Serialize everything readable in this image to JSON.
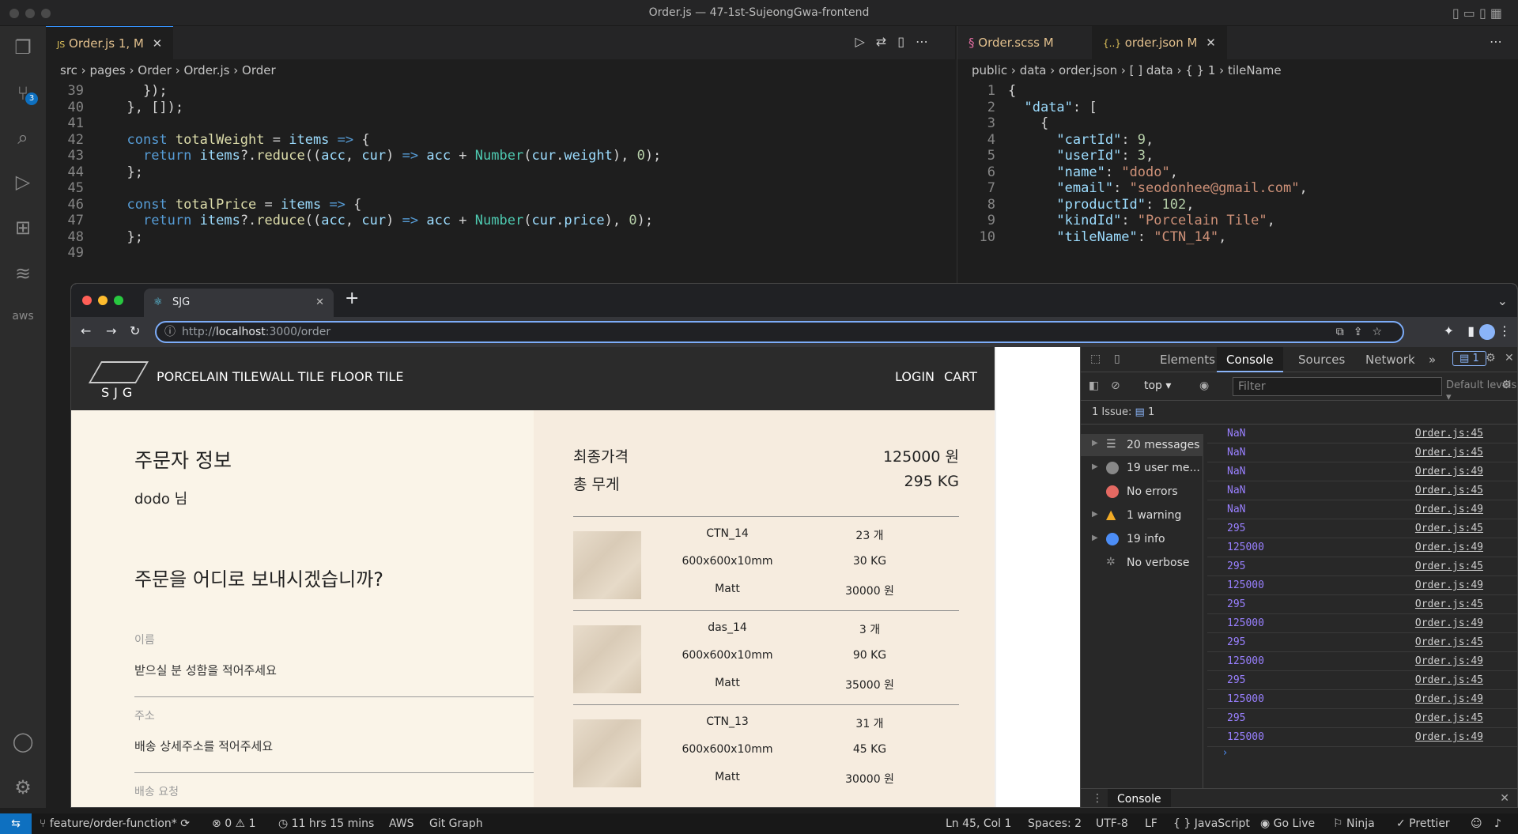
{
  "window": {
    "title": "Order.js — 47-1st-SujeongGwa-frontend"
  },
  "editor_left": {
    "tab_label": "Order.js",
    "tab_status": "1, M",
    "breadcrumb": [
      "src",
      "pages",
      "Order",
      "Order.js",
      "Order"
    ],
    "lines": [
      {
        "n": "39",
        "t": "    });"
      },
      {
        "n": "40",
        "t": "  }, []);"
      },
      {
        "n": "41",
        "t": ""
      },
      {
        "n": "42",
        "t": "  const totalWeight = items => {"
      },
      {
        "n": "43",
        "t": "    return items?.reduce((acc, cur) => acc + Number(cur.weight), 0);"
      },
      {
        "n": "44",
        "t": "  };"
      },
      {
        "n": "45",
        "t": ""
      },
      {
        "n": "46",
        "t": "  const totalPrice = items => {"
      },
      {
        "n": "47",
        "t": "    return items?.reduce((acc, cur) => acc + Number(cur.price), 0);"
      },
      {
        "n": "48",
        "t": "  };"
      },
      {
        "n": "49",
        "t": ""
      }
    ]
  },
  "editor_right": {
    "tabs": [
      {
        "label": "Order.scss",
        "status": "M"
      },
      {
        "label": "order.json",
        "status": "M"
      }
    ],
    "breadcrumb": [
      "public",
      "data",
      "order.json",
      "[ ] data",
      "{ } 1",
      "tileName"
    ],
    "lines": [
      {
        "n": "1",
        "t": "{"
      },
      {
        "n": "2",
        "t": "  \"data\": ["
      },
      {
        "n": "3",
        "t": "    {"
      },
      {
        "n": "4",
        "t": "      \"cartId\": 9,"
      },
      {
        "n": "5",
        "t": "      \"userId\": 3,"
      },
      {
        "n": "6",
        "t": "      \"name\": \"dodo\","
      },
      {
        "n": "7",
        "t": "      \"email\": \"seodonhee@gmail.com\","
      },
      {
        "n": "8",
        "t": "      \"productId\": 102,"
      },
      {
        "n": "9",
        "t": "      \"kindId\": \"Porcelain Tile\","
      },
      {
        "n": "10",
        "t": "      \"tileName\": \"CTN_14\","
      }
    ]
  },
  "activity_badge": "3",
  "browser": {
    "tab_title": "SJG",
    "url_prefix": "http://",
    "url_host": "localhost",
    "url_path": ":3000/order"
  },
  "site": {
    "logo": "SJG",
    "nav": [
      "PORCELAIN TILE",
      "WALL TILE",
      "FLOOR TILE"
    ],
    "nav_right": [
      "LOGIN",
      "CART"
    ],
    "orderer_title": "주문자 정보",
    "user_name": "dodo 님",
    "ship_title": "주문을 어디로 보내시겠습니까?",
    "fields": [
      {
        "label": "이름",
        "placeholder": "받으실 분 성함을 적어주세요"
      },
      {
        "label": "주소",
        "placeholder": "배송 상세주소를 적어주세요"
      },
      {
        "label": "배송 요청",
        "placeholder": ""
      }
    ],
    "summary": {
      "price_label": "최종가격",
      "price_value": "125000 원",
      "weight_label": "총 무게",
      "weight_value": "295 KG"
    },
    "products": [
      {
        "name": "CTN_14",
        "size": "600x600x10mm",
        "finish": "Matt",
        "qty": "23 개",
        "weight": "30 KG",
        "price": "30000 원"
      },
      {
        "name": "das_14",
        "size": "600x600x10mm",
        "finish": "Matt",
        "qty": "3 개",
        "weight": "90 KG",
        "price": "35000 원"
      },
      {
        "name": "CTN_13",
        "size": "600x600x10mm",
        "finish": "Matt",
        "qty": "31 개",
        "weight": "45 KG",
        "price": "30000 원"
      }
    ]
  },
  "devtools": {
    "tabs": [
      "Elements",
      "Console",
      "Sources",
      "Network"
    ],
    "issue_badge": "1",
    "context": "top",
    "filter_placeholder": "Filter",
    "levels": "Default levels",
    "issues_bar": "1 Issue:",
    "issues_count": "1",
    "sidebar": [
      "20 messages",
      "19 user me...",
      "No errors",
      "1 warning",
      "19 info",
      "No verbose"
    ],
    "messages": [
      {
        "v": "NaN",
        "s": "Order.js:45"
      },
      {
        "v": "NaN",
        "s": "Order.js:45"
      },
      {
        "v": "NaN",
        "s": "Order.js:49"
      },
      {
        "v": "NaN",
        "s": "Order.js:45"
      },
      {
        "v": "NaN",
        "s": "Order.js:49"
      },
      {
        "v": "295",
        "s": "Order.js:45"
      },
      {
        "v": "125000",
        "s": "Order.js:49"
      },
      {
        "v": "295",
        "s": "Order.js:45"
      },
      {
        "v": "125000",
        "s": "Order.js:49"
      },
      {
        "v": "295",
        "s": "Order.js:45"
      },
      {
        "v": "125000",
        "s": "Order.js:49"
      },
      {
        "v": "295",
        "s": "Order.js:45"
      },
      {
        "v": "125000",
        "s": "Order.js:49"
      },
      {
        "v": "295",
        "s": "Order.js:45"
      },
      {
        "v": "125000",
        "s": "Order.js:49"
      },
      {
        "v": "295",
        "s": "Order.js:45"
      },
      {
        "v": "125000",
        "s": "Order.js:49"
      }
    ],
    "drawer_tab": "Console"
  },
  "statusbar": {
    "branch": "feature/order-function*",
    "problems": "0",
    "warnings": "1",
    "time": "11 hrs 15 mins",
    "aws": "AWS",
    "gitgraph": "Git Graph",
    "position": "Ln 45, Col 1",
    "spaces": "Spaces: 2",
    "encoding": "UTF-8",
    "eol": "LF",
    "language": "JavaScript",
    "golive": "Go Live",
    "ninja": "Ninja",
    "prettier": "Prettier"
  }
}
